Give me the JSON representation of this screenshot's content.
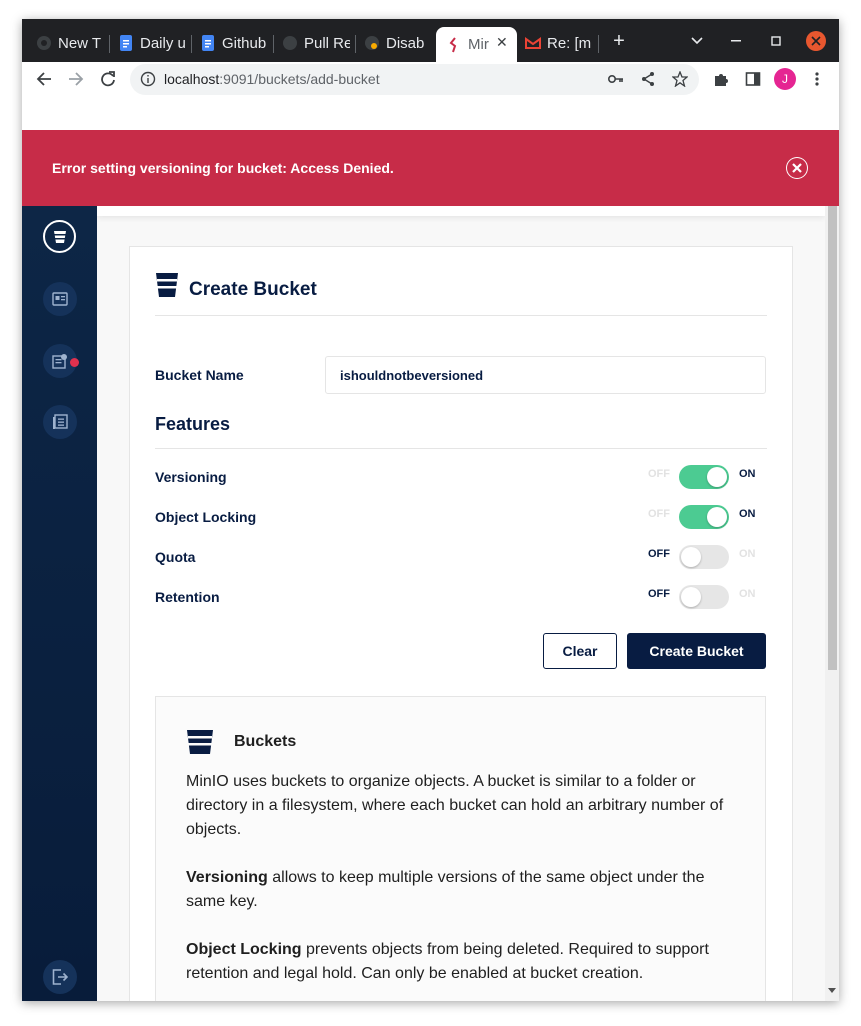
{
  "browser": {
    "tabs": [
      {
        "title": "New T",
        "icon": "chrome-icon"
      },
      {
        "title": "Daily u",
        "icon": "docs-icon"
      },
      {
        "title": "Github",
        "icon": "docs-icon"
      },
      {
        "title": "Pull Re",
        "icon": "github-icon"
      },
      {
        "title": "Disab",
        "icon": "chrome-icon"
      },
      {
        "title": "Mir",
        "icon": "minio-icon"
      },
      {
        "title": "Re: [m",
        "icon": "gmail-icon"
      }
    ],
    "url_host": "localhost",
    "url_path": ":9091/buckets/add-bucket",
    "profile_initial": "J"
  },
  "banner": {
    "message": "Error setting versioning for bucket: Access Denied."
  },
  "page": {
    "title": "Create Bucket",
    "bucket_name_label": "Bucket Name",
    "bucket_name_value": "ishouldnotbeversioned",
    "features_heading": "Features",
    "features": [
      {
        "label": "Versioning",
        "on": true
      },
      {
        "label": "Object Locking",
        "on": true
      },
      {
        "label": "Quota",
        "on": false
      },
      {
        "label": "Retention",
        "on": false
      }
    ],
    "switch_off_label": "OFF",
    "switch_on_label": "ON",
    "clear_button": "Clear",
    "create_button": "Create Bucket"
  },
  "help": {
    "title": "Buckets",
    "intro": "MinIO uses buckets to organize objects. A bucket is similar to a folder or directory in a filesystem, where each bucket can hold an arbitrary number of objects.",
    "versioning_term": "Versioning",
    "versioning_text": " allows to keep multiple versions of the same object under the same key.",
    "locking_term": "Object Locking",
    "locking_text": " prevents objects from being deleted. Required to support retention and legal hold. Can only be enabled at bucket creation."
  },
  "colors": {
    "banner": "#c72c48",
    "sidebar": "#0d2646",
    "toggle_on": "#4ccb92",
    "primary_button": "#081c42"
  }
}
